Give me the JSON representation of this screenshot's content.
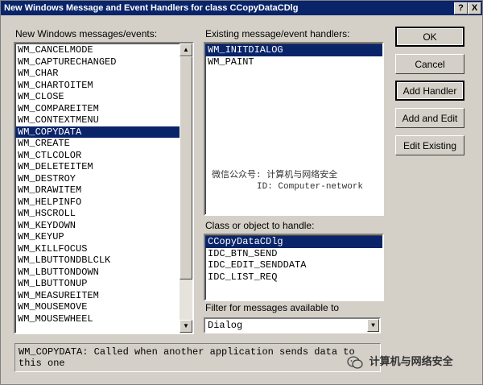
{
  "window": {
    "title": "New Windows Message and Event Handlers for class CCopyDataCDlg",
    "help_button": "?",
    "close_button": "X"
  },
  "messages_list": {
    "label": "New Windows messages/events:",
    "selected": "WM_COPYDATA",
    "items": [
      "WM_CANCELMODE",
      "WM_CAPTURECHANGED",
      "WM_CHAR",
      "WM_CHARTOITEM",
      "WM_CLOSE",
      "WM_COMPAREITEM",
      "WM_CONTEXTMENU",
      "WM_COPYDATA",
      "WM_CREATE",
      "WM_CTLCOLOR",
      "WM_DELETEITEM",
      "WM_DESTROY",
      "WM_DRAWITEM",
      "WM_HELPINFO",
      "WM_HSCROLL",
      "WM_KEYDOWN",
      "WM_KEYUP",
      "WM_KILLFOCUS",
      "WM_LBUTTONDBLCLK",
      "WM_LBUTTONDOWN",
      "WM_LBUTTONUP",
      "WM_MEASUREITEM",
      "WM_MOUSEMOVE",
      "WM_MOUSEWHEEL"
    ]
  },
  "existing_handlers": {
    "label": "Existing message/event handlers:",
    "selected": "WM_INITDIALOG",
    "items": [
      "WM_INITDIALOG",
      "WM_PAINT"
    ]
  },
  "watermark": {
    "line1": "微信公众号: 计算机与网络安全",
    "line2": "ID: Computer-network"
  },
  "class_list": {
    "label": "Class or object to handle:",
    "selected": "CCopyDataCDlg",
    "items": [
      "CCopyDataCDlg",
      "IDC_BTN_SEND",
      "IDC_EDIT_SENDDATA",
      "IDC_LIST_REQ"
    ]
  },
  "filter": {
    "label": "Filter for messages available to",
    "value": "Dialog"
  },
  "buttons": {
    "ok": "OK",
    "cancel": "Cancel",
    "add_handler": "Add Handler",
    "add_and_edit": "Add and Edit",
    "edit_existing": "Edit Existing"
  },
  "status": {
    "text": "WM_COPYDATA:  Called when another application sends data to this one"
  },
  "branding": {
    "text": "计算机与网络安全"
  }
}
